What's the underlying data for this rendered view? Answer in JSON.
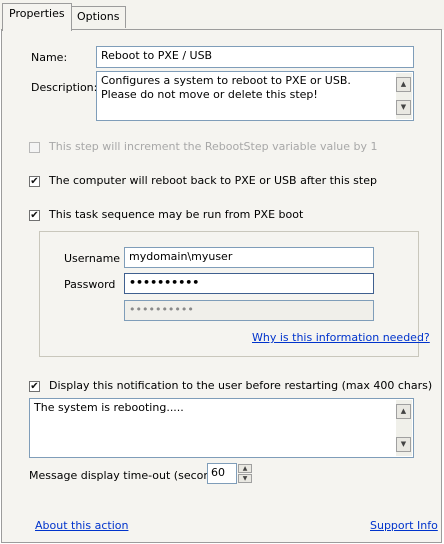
{
  "tabs": [
    {
      "label": "Properties",
      "active": true
    },
    {
      "label": "Options",
      "active": false
    }
  ],
  "name": {
    "label": "Name:",
    "value": "Reboot to PXE / USB"
  },
  "description": {
    "label": "Description:",
    "value": "Configures a system to reboot to PXE or USB. Please do not move or delete this step!"
  },
  "checks": {
    "increment": {
      "label": "This step will increment the RebootStep variable value by 1",
      "checked": false,
      "enabled": false
    },
    "reboot_back": {
      "label": "The computer will reboot back to PXE or USB after this step",
      "checked": true
    },
    "pxe_boot": {
      "label": "This task sequence may be run from PXE boot",
      "checked": true
    },
    "notify": {
      "label": "Display this notification to the user before restarting (max 400 chars)",
      "checked": true
    }
  },
  "credentials": {
    "username_label": "Username",
    "username_value": "mydomain\\myuser",
    "password_label": "Password",
    "password_value": "••••••••••",
    "confirm_value": "••••••••••",
    "why_link": "Why is this information needed?"
  },
  "notification_text": "The system is rebooting.....",
  "timeout": {
    "label": "Message display time-out (seconds)",
    "value": "60"
  },
  "footer": {
    "about": "About this action",
    "support": "Support Info"
  },
  "icons": {
    "check": "✔",
    "scroll_up": "▲",
    "scroll_down": "▼"
  }
}
